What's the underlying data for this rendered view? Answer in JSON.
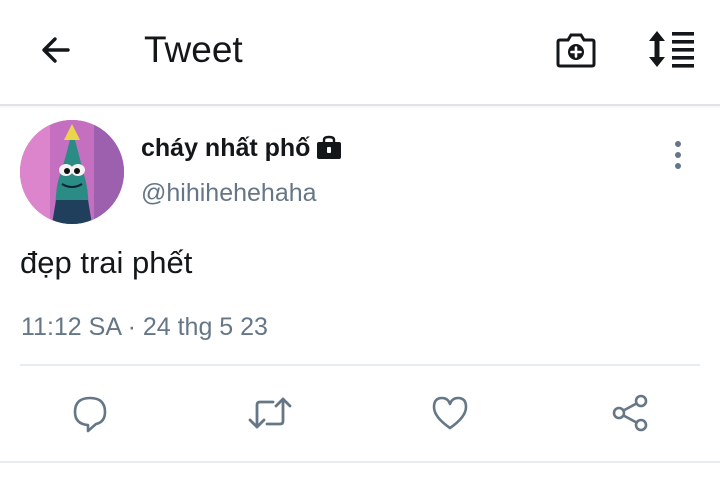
{
  "header": {
    "title": "Tweet",
    "back_icon": "arrow-left-icon",
    "camera_icon": "camera-plus-icon",
    "sort_icon": "sort-lines-icon"
  },
  "tweet": {
    "display_name": "cháy nhất phố",
    "handle": "@hihihehehaha",
    "protected_icon": "lock-icon",
    "text": "đẹp trai phết",
    "timestamp": "11:12 SA · 24 thg 5 23",
    "more_icon": "more-vertical-icon"
  },
  "actions": {
    "reply_icon": "reply-icon",
    "retweet_icon": "retweet-icon",
    "like_icon": "heart-icon",
    "share_icon": "share-icon"
  },
  "colors": {
    "text": "#14171a",
    "secondary": "#657786",
    "icon": "#657786",
    "divider": "#e6ecf0"
  }
}
